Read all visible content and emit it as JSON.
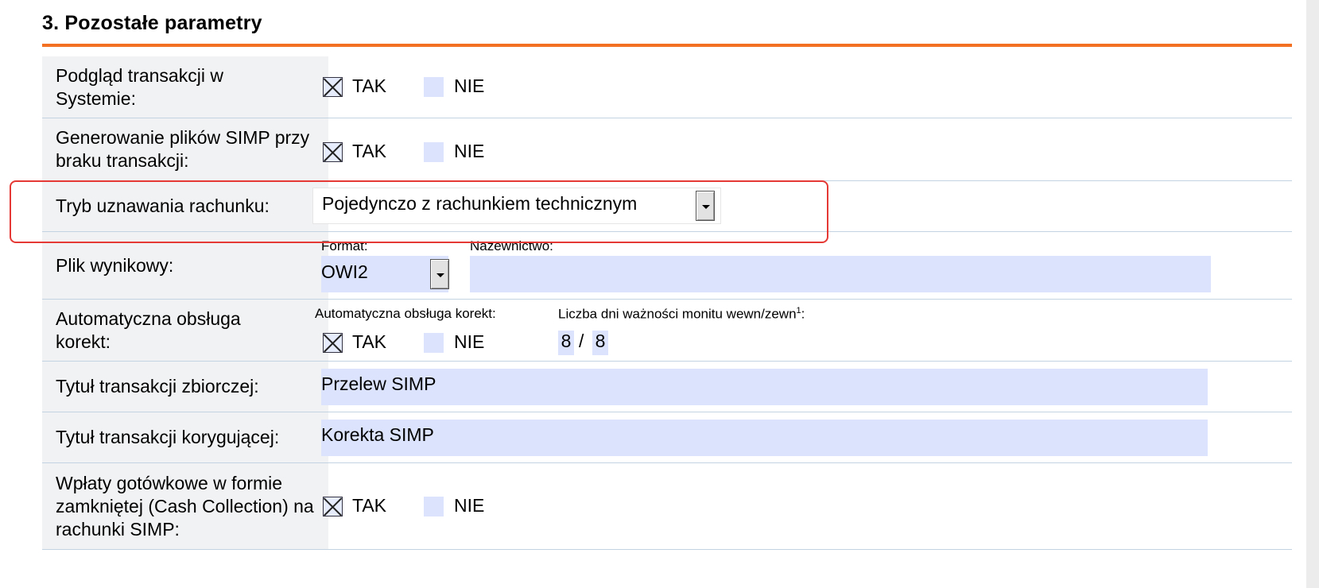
{
  "section": {
    "title": "3. Pozostałe parametry"
  },
  "rows": {
    "preview": {
      "label": "Podgląd transakcji w Systemie:",
      "yes": "TAK",
      "no": "NIE",
      "value": "TAK"
    },
    "generate": {
      "label": "Generowanie plików SIMP przy braku transakcji:",
      "yes": "TAK",
      "no": "NIE",
      "value": "TAK"
    },
    "mode": {
      "label": "Tryb uznawania rachunku:",
      "selected": "Pojedynczo z rachunkiem technicznym"
    },
    "output": {
      "label": "Plik wynikowy:",
      "format_label": "Format:",
      "format_value": "OWI2",
      "name_label": "Nazewnictwo:",
      "name_value": ""
    },
    "corrections": {
      "label": "Automatyczna obsługa korekt:",
      "sub_label": "Automatyczna obsługa korekt:",
      "yes": "TAK",
      "no": "NIE",
      "value": "TAK",
      "days_label": "Liczba dni ważności monitu wewn/zewn",
      "days_sup": "1",
      "days_colon": ":",
      "internal": "8",
      "separator": "/",
      "external": "8"
    },
    "collective_title": {
      "label": "Tytuł transakcji zbiorczej:",
      "value": "Przelew SIMP"
    },
    "correction_title": {
      "label": "Tytuł transakcji korygującej:",
      "value": "Korekta SIMP"
    },
    "cash": {
      "label": "Wpłaty gotówkowe w formie zamkniętej (Cash Collection) na rachunki SIMP:",
      "yes": "TAK",
      "no": "NIE",
      "value": "TAK"
    }
  },
  "colors": {
    "accent_rule": "#f36f21",
    "field_bg": "#dce4fd",
    "highlight": "#e53935",
    "label_bg": "#f1f2f3"
  }
}
